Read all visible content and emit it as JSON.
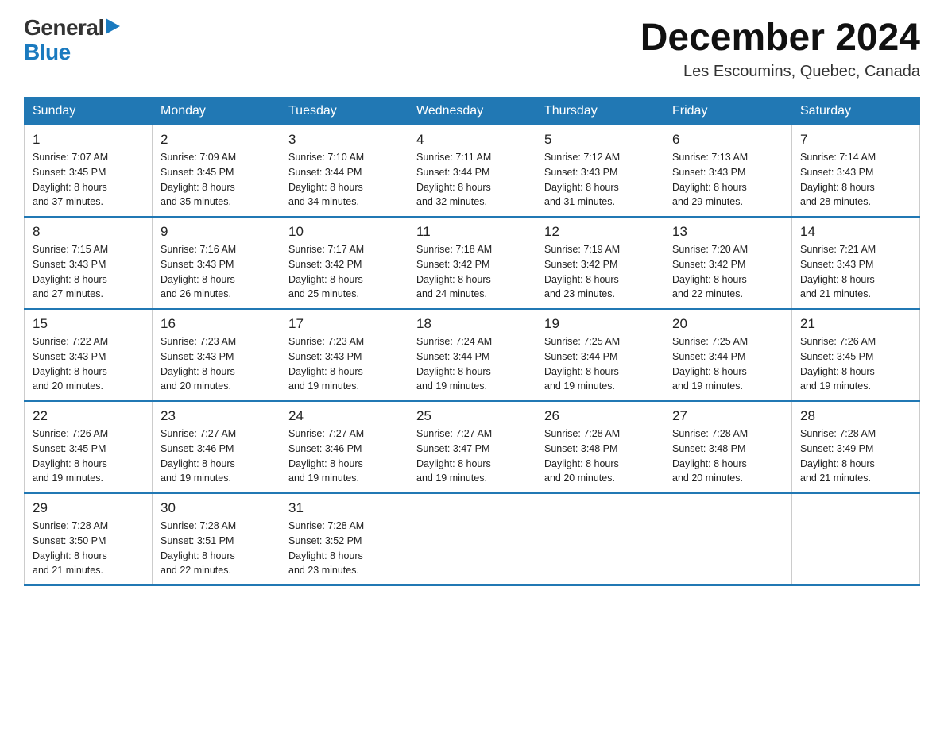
{
  "header": {
    "logo_general": "General",
    "logo_blue": "Blue",
    "month_title": "December 2024",
    "subtitle": "Les Escoumins, Quebec, Canada"
  },
  "days_of_week": [
    "Sunday",
    "Monday",
    "Tuesday",
    "Wednesday",
    "Thursday",
    "Friday",
    "Saturday"
  ],
  "weeks": [
    [
      {
        "num": "1",
        "sunrise": "7:07 AM",
        "sunset": "3:45 PM",
        "daylight": "8 hours and 37 minutes."
      },
      {
        "num": "2",
        "sunrise": "7:09 AM",
        "sunset": "3:45 PM",
        "daylight": "8 hours and 35 minutes."
      },
      {
        "num": "3",
        "sunrise": "7:10 AM",
        "sunset": "3:44 PM",
        "daylight": "8 hours and 34 minutes."
      },
      {
        "num": "4",
        "sunrise": "7:11 AM",
        "sunset": "3:44 PM",
        "daylight": "8 hours and 32 minutes."
      },
      {
        "num": "5",
        "sunrise": "7:12 AM",
        "sunset": "3:43 PM",
        "daylight": "8 hours and 31 minutes."
      },
      {
        "num": "6",
        "sunrise": "7:13 AM",
        "sunset": "3:43 PM",
        "daylight": "8 hours and 29 minutes."
      },
      {
        "num": "7",
        "sunrise": "7:14 AM",
        "sunset": "3:43 PM",
        "daylight": "8 hours and 28 minutes."
      }
    ],
    [
      {
        "num": "8",
        "sunrise": "7:15 AM",
        "sunset": "3:43 PM",
        "daylight": "8 hours and 27 minutes."
      },
      {
        "num": "9",
        "sunrise": "7:16 AM",
        "sunset": "3:43 PM",
        "daylight": "8 hours and 26 minutes."
      },
      {
        "num": "10",
        "sunrise": "7:17 AM",
        "sunset": "3:42 PM",
        "daylight": "8 hours and 25 minutes."
      },
      {
        "num": "11",
        "sunrise": "7:18 AM",
        "sunset": "3:42 PM",
        "daylight": "8 hours and 24 minutes."
      },
      {
        "num": "12",
        "sunrise": "7:19 AM",
        "sunset": "3:42 PM",
        "daylight": "8 hours and 23 minutes."
      },
      {
        "num": "13",
        "sunrise": "7:20 AM",
        "sunset": "3:42 PM",
        "daylight": "8 hours and 22 minutes."
      },
      {
        "num": "14",
        "sunrise": "7:21 AM",
        "sunset": "3:43 PM",
        "daylight": "8 hours and 21 minutes."
      }
    ],
    [
      {
        "num": "15",
        "sunrise": "7:22 AM",
        "sunset": "3:43 PM",
        "daylight": "8 hours and 20 minutes."
      },
      {
        "num": "16",
        "sunrise": "7:23 AM",
        "sunset": "3:43 PM",
        "daylight": "8 hours and 20 minutes."
      },
      {
        "num": "17",
        "sunrise": "7:23 AM",
        "sunset": "3:43 PM",
        "daylight": "8 hours and 19 minutes."
      },
      {
        "num": "18",
        "sunrise": "7:24 AM",
        "sunset": "3:44 PM",
        "daylight": "8 hours and 19 minutes."
      },
      {
        "num": "19",
        "sunrise": "7:25 AM",
        "sunset": "3:44 PM",
        "daylight": "8 hours and 19 minutes."
      },
      {
        "num": "20",
        "sunrise": "7:25 AM",
        "sunset": "3:44 PM",
        "daylight": "8 hours and 19 minutes."
      },
      {
        "num": "21",
        "sunrise": "7:26 AM",
        "sunset": "3:45 PM",
        "daylight": "8 hours and 19 minutes."
      }
    ],
    [
      {
        "num": "22",
        "sunrise": "7:26 AM",
        "sunset": "3:45 PM",
        "daylight": "8 hours and 19 minutes."
      },
      {
        "num": "23",
        "sunrise": "7:27 AM",
        "sunset": "3:46 PM",
        "daylight": "8 hours and 19 minutes."
      },
      {
        "num": "24",
        "sunrise": "7:27 AM",
        "sunset": "3:46 PM",
        "daylight": "8 hours and 19 minutes."
      },
      {
        "num": "25",
        "sunrise": "7:27 AM",
        "sunset": "3:47 PM",
        "daylight": "8 hours and 19 minutes."
      },
      {
        "num": "26",
        "sunrise": "7:28 AM",
        "sunset": "3:48 PM",
        "daylight": "8 hours and 20 minutes."
      },
      {
        "num": "27",
        "sunrise": "7:28 AM",
        "sunset": "3:48 PM",
        "daylight": "8 hours and 20 minutes."
      },
      {
        "num": "28",
        "sunrise": "7:28 AM",
        "sunset": "3:49 PM",
        "daylight": "8 hours and 21 minutes."
      }
    ],
    [
      {
        "num": "29",
        "sunrise": "7:28 AM",
        "sunset": "3:50 PM",
        "daylight": "8 hours and 21 minutes."
      },
      {
        "num": "30",
        "sunrise": "7:28 AM",
        "sunset": "3:51 PM",
        "daylight": "8 hours and 22 minutes."
      },
      {
        "num": "31",
        "sunrise": "7:28 AM",
        "sunset": "3:52 PM",
        "daylight": "8 hours and 23 minutes."
      },
      null,
      null,
      null,
      null
    ]
  ],
  "labels": {
    "sunrise": "Sunrise:",
    "sunset": "Sunset:",
    "daylight": "Daylight:"
  }
}
